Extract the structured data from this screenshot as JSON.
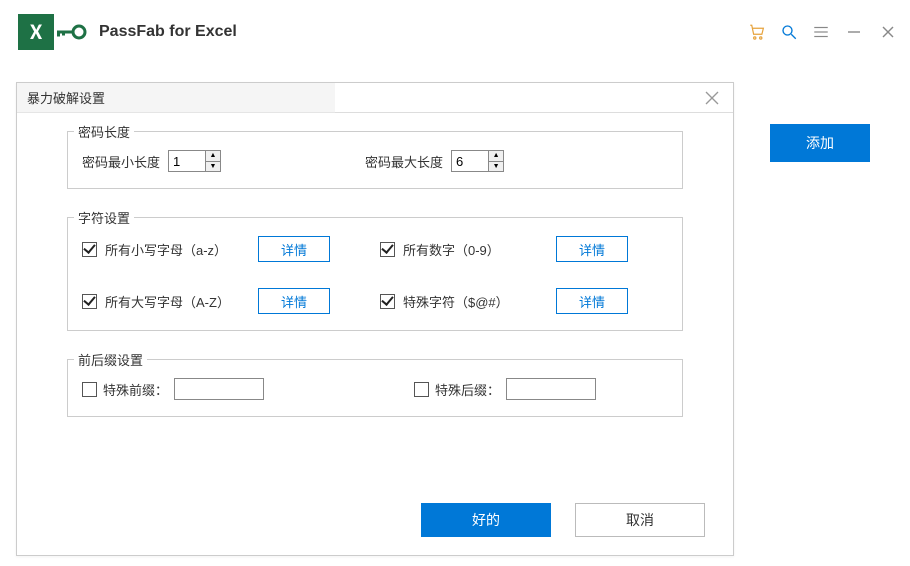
{
  "app": {
    "title": "PassFab for Excel"
  },
  "sidebar": {
    "add_label": "添加"
  },
  "dialog": {
    "title": "暴力破解设置",
    "ok_label": "好的",
    "cancel_label": "取消",
    "length": {
      "legend": "密码长度",
      "min_label": "密码最小长度",
      "min_value": "1",
      "max_label": "密码最大长度",
      "max_value": "6"
    },
    "charset": {
      "legend": "字符设置",
      "items": [
        {
          "label": "所有小写字母（a-z）",
          "checked": true
        },
        {
          "label": "所有数字（0-9）",
          "checked": true
        },
        {
          "label": "所有大写字母（A-Z）",
          "checked": true
        },
        {
          "label": "特殊字符（$@#）",
          "checked": true
        }
      ],
      "detail_label": "详情"
    },
    "affix": {
      "legend": "前后缀设置",
      "prefix_label": "特殊前缀：",
      "prefix_value": "",
      "suffix_label": "特殊后缀：",
      "suffix_value": ""
    }
  }
}
